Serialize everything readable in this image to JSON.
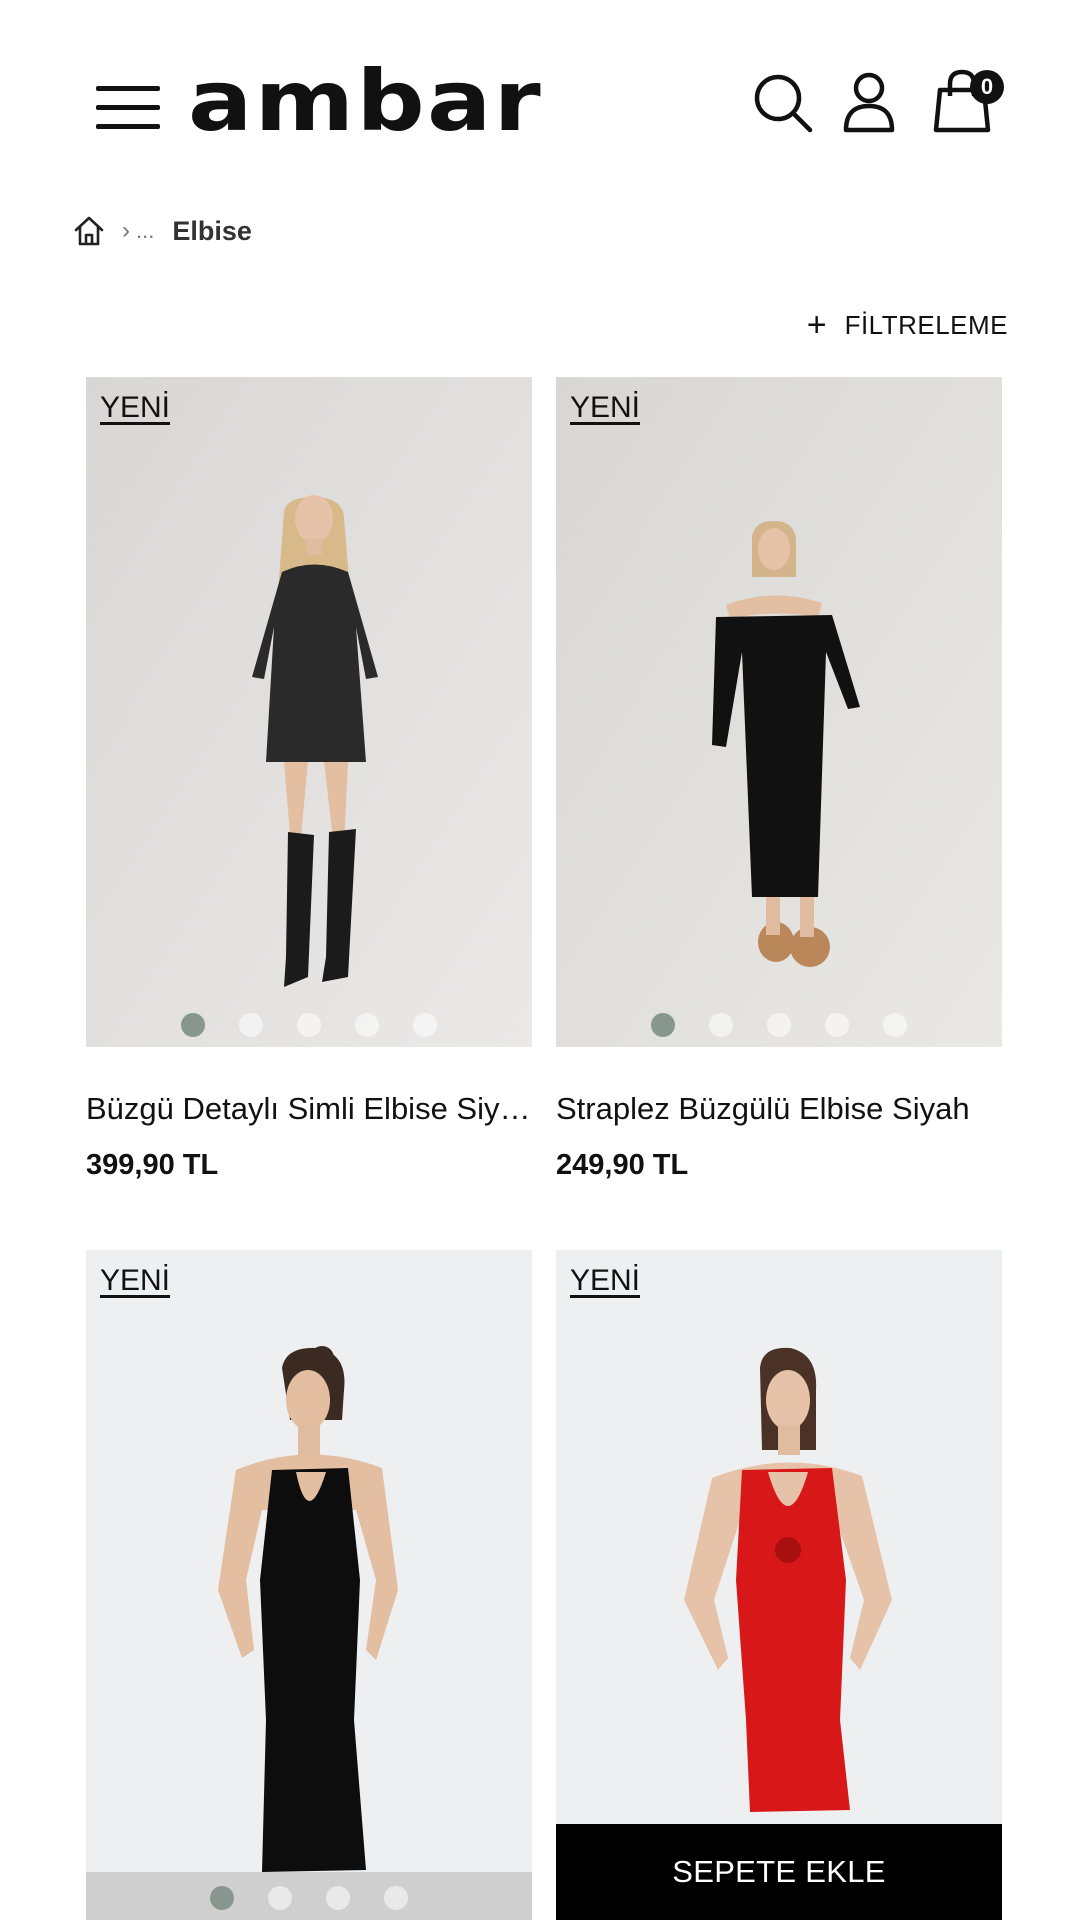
{
  "header": {
    "logo_text": "ambar",
    "menu_icon": "hamburger-icon",
    "search_icon": "search-icon",
    "user_icon": "user-icon",
    "cart_icon": "shopping-bag-icon",
    "cart_count": "0"
  },
  "breadcrumb": {
    "home_icon": "home-icon",
    "separator": "›",
    "ellipsis": "...",
    "current": "Elbise"
  },
  "filter": {
    "icon": "plus-icon",
    "label": "FİLTRELEME"
  },
  "products": [
    {
      "badge": "YENİ",
      "title": "Büzgü Detaylı Simli Elbise Siyah",
      "price": "399,90 TL",
      "dress_color": "#2a2a2a",
      "active_dot": 1
    },
    {
      "badge": "YENİ",
      "title": "Straplez Büzgülü Elbise Siyah",
      "price": "249,90 TL",
      "dress_color": "#111111",
      "active_dot": 1
    },
    {
      "badge": "YENİ",
      "dress_color": "#0d0d0d",
      "active_dot": 1
    },
    {
      "badge": "YENİ",
      "dress_color": "#d81818",
      "add_to_cart": "SEPETE EKLE"
    }
  ],
  "colors": {
    "accent_dot": "#87968f",
    "button_bg": "#000000"
  }
}
